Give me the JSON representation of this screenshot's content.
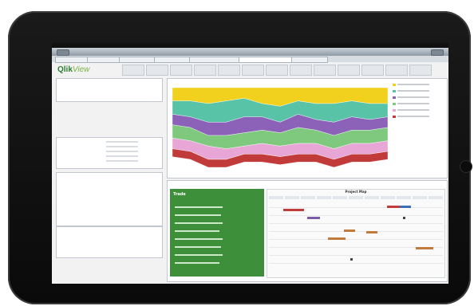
{
  "app": {
    "status_carrier": "",
    "status_time": "",
    "status_battery": "",
    "window_title": "",
    "logo_main": "Qlik",
    "logo_sub": "View"
  },
  "tabs": [
    {
      "label": ""
    },
    {
      "label": ""
    },
    {
      "label": ""
    },
    {
      "label": ""
    },
    {
      "label": ""
    },
    {
      "label": "",
      "active": true
    },
    {
      "label": ""
    }
  ],
  "colors": {
    "brand_green": "#3d8f3a",
    "accent_yellow": "#f2d01e",
    "accent_teal": "#58c3a7",
    "accent_purple": "#8b62b8",
    "accent_red": "#c23b3b",
    "accent_lightgreen": "#9fd36b"
  },
  "bottom_panel": {
    "green_title": "Trade"
  },
  "gantt": {
    "title": "Project Map"
  },
  "chart_data": {
    "type": "area",
    "title": "",
    "categories": [
      "",
      "",
      "",
      "",
      "",
      "",
      "",
      "",
      "",
      "",
      "",
      "",
      ""
    ],
    "legend_placement": "right",
    "series": [
      {
        "color": "#f2d01e",
        "values": [
          10,
          10,
          12,
          10,
          8,
          12,
          14,
          10,
          12,
          12,
          10,
          12,
          12
        ]
      },
      {
        "color": "#58c3a7",
        "values": [
          10,
          12,
          14,
          16,
          14,
          10,
          12,
          10,
          12,
          14,
          12,
          12,
          10
        ]
      },
      {
        "color": "#8b62b8",
        "values": [
          8,
          8,
          10,
          10,
          12,
          10,
          8,
          10,
          8,
          10,
          10,
          8,
          8
        ]
      },
      {
        "color": "#7fc97f",
        "values": [
          10,
          10,
          8,
          10,
          10,
          10,
          10,
          12,
          10,
          10,
          10,
          10,
          10
        ]
      },
      {
        "color": "#e7a6d5",
        "values": [
          8,
          8,
          10,
          8,
          6,
          8,
          8,
          8,
          8,
          8,
          8,
          8,
          8
        ]
      },
      {
        "color": "#c23b3b",
        "values": [
          6,
          6,
          6,
          6,
          6,
          6,
          6,
          6,
          6,
          6,
          6,
          6,
          6
        ]
      }
    ]
  }
}
